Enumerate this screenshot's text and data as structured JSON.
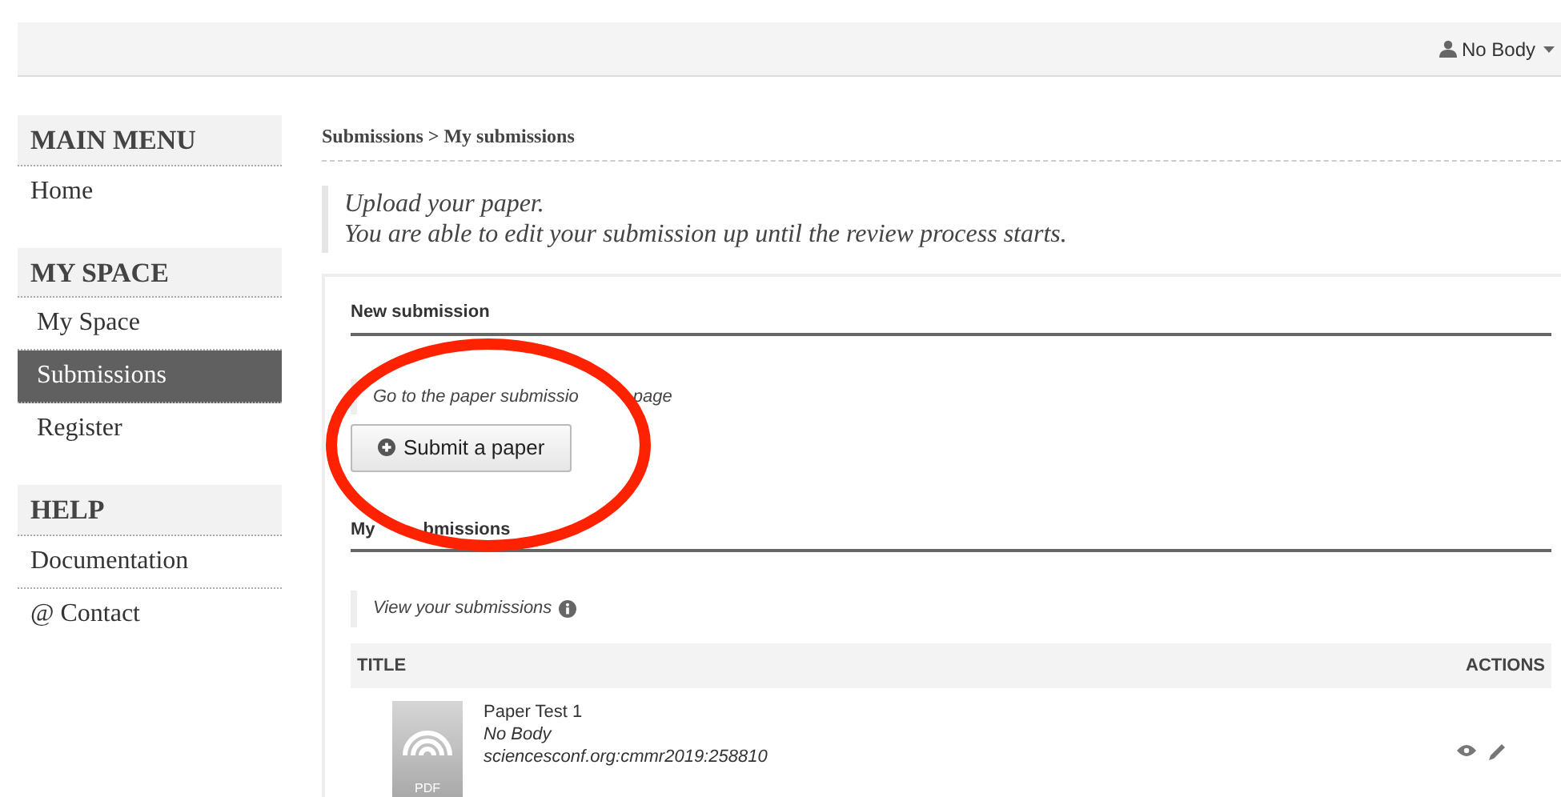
{
  "navbar": {
    "user": "No Body"
  },
  "sidebar": [
    {
      "heading": "MAIN MENU",
      "items": [
        {
          "label": "Home",
          "selected": false
        }
      ]
    },
    {
      "heading": "MY SPACE",
      "items": [
        {
          "label": "My Space",
          "selected": false
        },
        {
          "label": "Submissions",
          "selected": true
        },
        {
          "label": "Register",
          "selected": false
        }
      ]
    },
    {
      "heading": "HELP",
      "items": [
        {
          "label": "Documentation",
          "selected": false
        },
        {
          "label": "@ Contact",
          "selected": false
        }
      ]
    }
  ],
  "breadcrumb": "Submissions > My submissions",
  "intro": [
    "Upload your paper.",
    "You are able to edit your submission up until the review process starts."
  ],
  "new_submission": {
    "heading": "New submission",
    "note_parts": [
      "Go to the paper submissio",
      "page"
    ],
    "button": "Submit a paper"
  },
  "my_submissions": {
    "heading_parts": [
      "My",
      "bmissions"
    ],
    "note": "View your submissions",
    "table": {
      "columns": [
        "TITLE",
        "ACTIONS"
      ],
      "rows": [
        {
          "file_type": "PDF",
          "title": "Paper Test 1",
          "author": "No Body",
          "id": "sciencesconf.org:cmmr2019:258810"
        }
      ]
    }
  },
  "annotation": {
    "kind": "ellipse",
    "color": "#ff2200"
  }
}
